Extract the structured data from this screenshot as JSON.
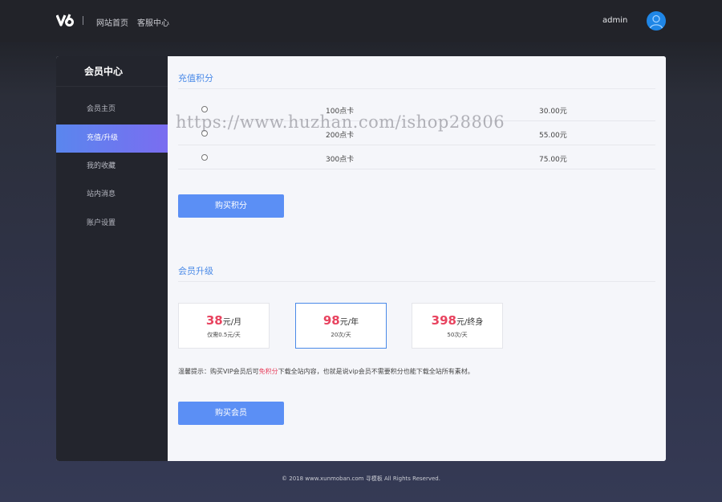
{
  "header": {
    "logo_text": "V6",
    "nav": [
      "网站首页",
      "客服中心"
    ],
    "username": "admin"
  },
  "sidebar": {
    "title": "会员中心",
    "items": [
      {
        "label": "会员主页"
      },
      {
        "label": "充值/升级"
      },
      {
        "label": "我的收藏"
      },
      {
        "label": "站内消息"
      },
      {
        "label": "账户设置"
      }
    ]
  },
  "recharge": {
    "title": "充值积分",
    "options": [
      {
        "name": "100点卡",
        "price": "30.00元"
      },
      {
        "name": "200点卡",
        "price": "55.00元"
      },
      {
        "name": "300点卡",
        "price": "75.00元"
      }
    ],
    "button": "购买积分"
  },
  "watermark": "https://www.huzhan.com/ishop28806",
  "upgrade": {
    "title": "会员升级",
    "plans": [
      {
        "price": "38",
        "unit": "元/月",
        "note": "仅需0.5元/天",
        "selected": false
      },
      {
        "price": "98",
        "unit": "元/年",
        "note": "20次/天",
        "selected": true
      },
      {
        "price": "398",
        "unit": "元/终身",
        "note": "50次/天",
        "selected": false
      }
    ],
    "tip_before": "温馨提示：购买VIP会员后可",
    "tip_highlight": "免积分",
    "tip_after": "下载全站内容，也就是说vip会员不需要积分也能下载全站所有素材。",
    "button": "购买会员"
  },
  "footer": "© 2018 www.xunmoban.com 寻模板 All Rights Reserved.",
  "colors": {
    "accent": "#4a8ae8",
    "button": "#5b8ff5",
    "price_highlight": "#e8435f",
    "sidebar_bg": "#23252d"
  }
}
